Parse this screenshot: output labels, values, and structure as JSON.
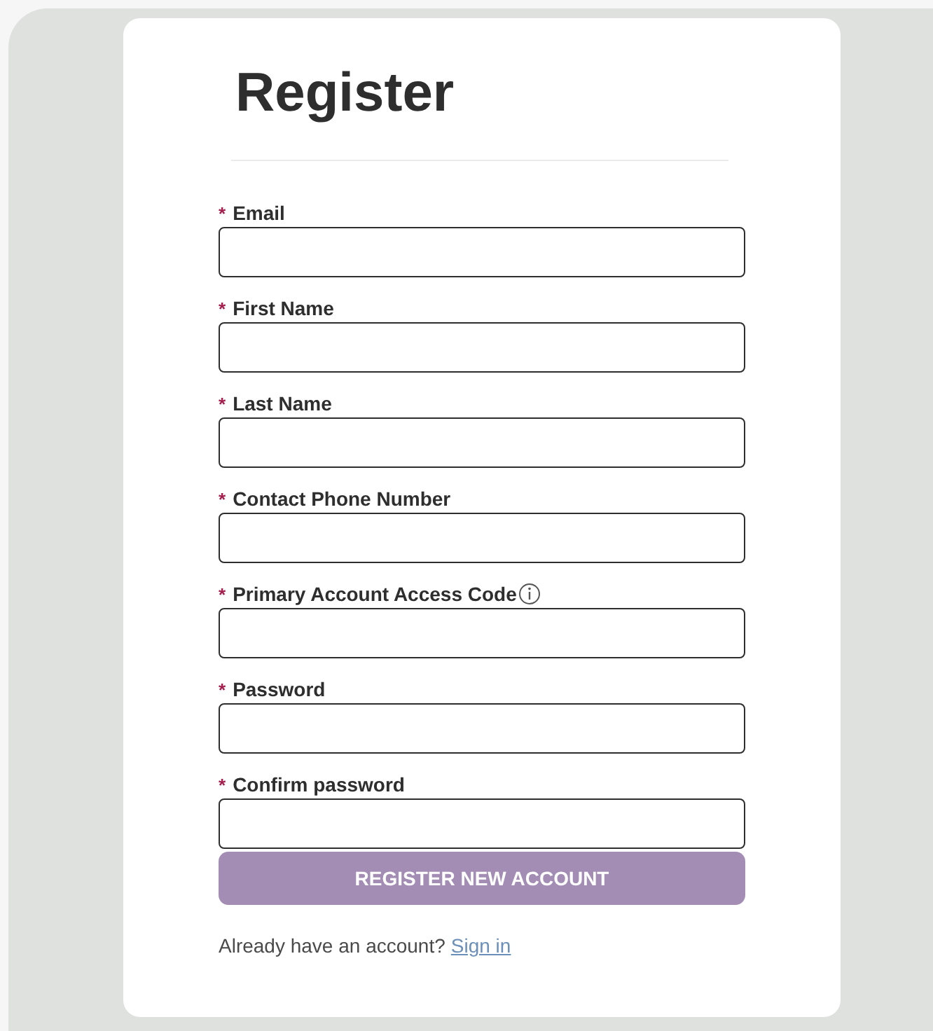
{
  "title": "Register",
  "fields": [
    {
      "label": "Email",
      "required_mark": "*",
      "info": false
    },
    {
      "label": "First Name",
      "required_mark": "*",
      "info": false
    },
    {
      "label": "Last Name",
      "required_mark": "*",
      "info": false
    },
    {
      "label": "Contact Phone Number",
      "required_mark": "*",
      "info": false
    },
    {
      "label": "Primary Account Access Code",
      "required_mark": "*",
      "info": true
    },
    {
      "label": "Password",
      "required_mark": "*",
      "info": false
    },
    {
      "label": "Confirm password",
      "required_mark": "*",
      "info": false
    }
  ],
  "submit": "REGISTER NEW ACCOUNT",
  "footer": {
    "text": "Already have an account?",
    "link": "Sign in"
  }
}
